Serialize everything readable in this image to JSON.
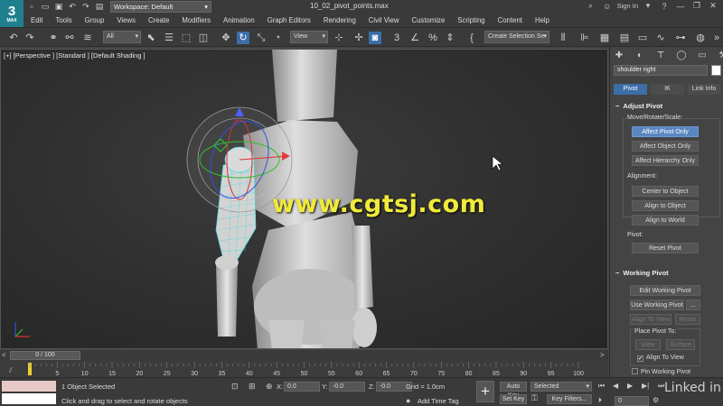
{
  "app": {
    "logo_big": "3",
    "logo_small": "MAX",
    "workspace": "Workspace: Default",
    "filename": "10_02_pivot_points.max",
    "sign_in": "Sign In",
    "help_icon": "?",
    "minimize": "—",
    "maximize": "❐",
    "close": "✕"
  },
  "menu": [
    "Edit",
    "Tools",
    "Group",
    "Views",
    "Create",
    "Modifiers",
    "Animation",
    "Graph Editors",
    "Rendering",
    "Civil View",
    "Customize",
    "Scripting",
    "Content",
    "Help"
  ],
  "toolbar": {
    "selection_filter": "All",
    "reference_coord": "View",
    "named_selection": "Create Selection Se",
    "snaps_label": "3"
  },
  "viewport": {
    "label": "[+] [Perspective ] [Standard ] [Default Shading ]",
    "watermark": "www.cgtsj.com",
    "colors": {
      "selection_wire": "#39d9e0",
      "gizmo_x": "#e03030",
      "gizmo_y": "#2fbf2f",
      "gizmo_z": "#3050e0"
    }
  },
  "command_panel": {
    "object_name": "shoulder right",
    "tabs": [
      "Pivot",
      "IK",
      "Link Info"
    ],
    "adjust_pivot": {
      "title": "Adjust Pivot",
      "move_group": "Move/Rotate/Scale:",
      "affect_pivot_only": "Affect Pivot Only",
      "affect_object_only": "Affect Object Only",
      "affect_hierarchy_only": "Affect Hierarchy Only",
      "alignment_group": "Alignment:",
      "center_to_object": "Center to Object",
      "align_to_object": "Align to Object",
      "align_to_world": "Align to World",
      "pivot_group": "Pivot:",
      "reset_pivot": "Reset Pivot"
    },
    "working_pivot": {
      "title": "Working Pivot",
      "edit_working_pivot": "Edit Working Pivot",
      "use_working_pivot": "Use Working Pivot",
      "more": "...",
      "align_to_view": "Align To View",
      "reset": "Reset",
      "place_pivot_to": "Place Pivot To:",
      "view": "View",
      "surface": "Surface",
      "align_to_view_chk": "Align To View",
      "pin_working_pivot": "Pin Working Pivot"
    }
  },
  "timeline": {
    "frame_display": "0 / 100",
    "left_arrow": "<",
    "right_arrow": ">",
    "ticks": [
      "5",
      "10",
      "15",
      "20",
      "25",
      "30",
      "35",
      "40",
      "45",
      "50",
      "55",
      "60",
      "65",
      "70",
      "75",
      "80",
      "85",
      "90",
      "95",
      "100"
    ]
  },
  "status": {
    "selected": "1 Object Selected",
    "prompt": "Click and drag to select and rotate objects",
    "x_label": "X:",
    "x_val": "0.0",
    "y_label": "Y:",
    "y_val": "-0.0",
    "z_label": "Z:",
    "z_val": "-0.0",
    "grid": "Grid = 1.0cm",
    "add_time_tag": "Add Time Tag",
    "auto_key": "Auto Key",
    "set_key": "Set Key",
    "selected_dd": "Selected",
    "key_filters": "Key Filters...",
    "current_frame": "0",
    "linkedin": "Linked in"
  }
}
